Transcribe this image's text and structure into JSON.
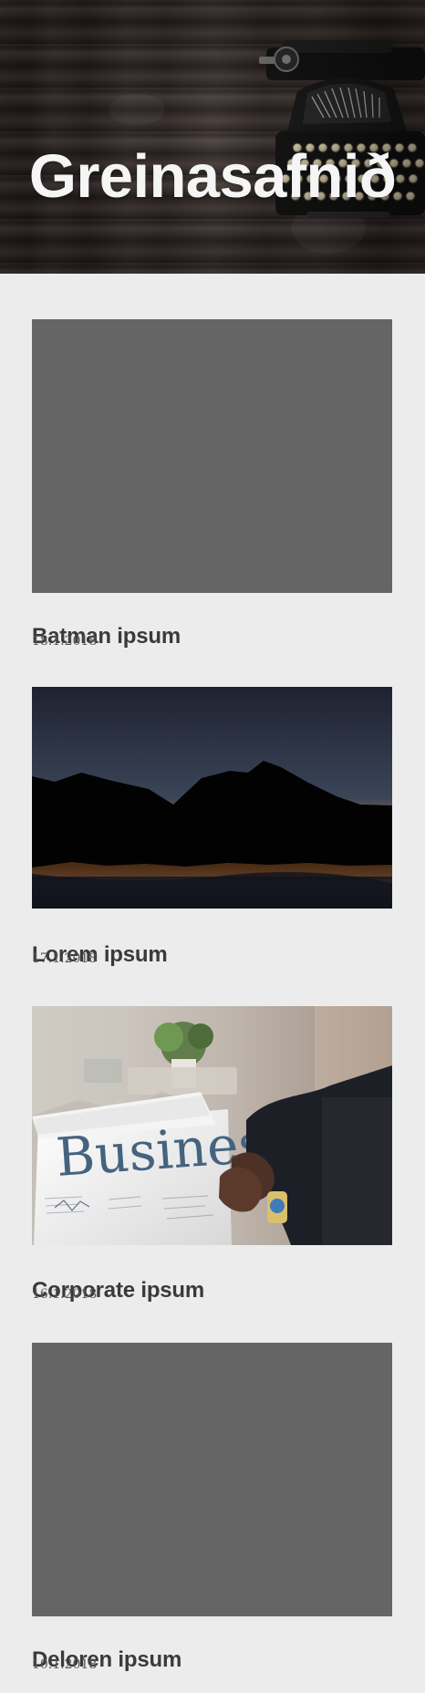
{
  "header": {
    "title": "Greinasafnið"
  },
  "articles": [
    {
      "title": "Batman ipsum",
      "date": "18.1.2018",
      "image": "gray-placeholder"
    },
    {
      "title": "Lorem ipsum",
      "date": "17.1.2018",
      "image": "mountain-sunset-photo"
    },
    {
      "title": "Corporate ipsum",
      "date": "16.1.2018",
      "image": "business-newspaper-photo",
      "image_text": "Business"
    },
    {
      "title": "Deloren ipsum",
      "date": "10.1.2018",
      "image": "gray-placeholder"
    }
  ]
}
